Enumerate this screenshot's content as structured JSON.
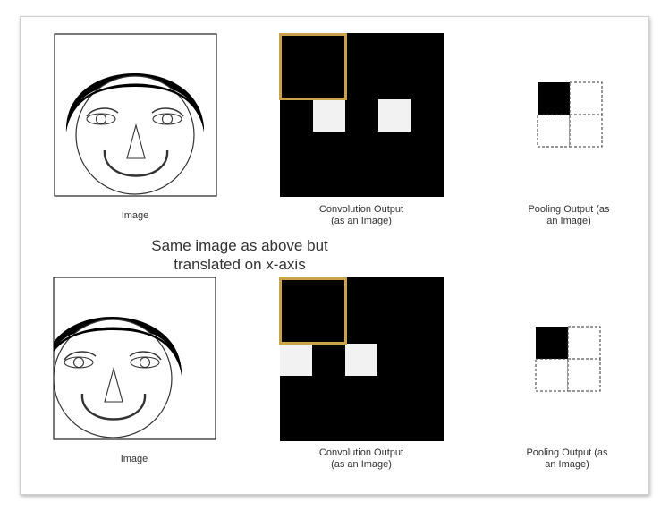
{
  "top_row": {
    "image_label": "Image",
    "conv_label_line1": "Convolution Output",
    "conv_label_line2": "(as an Image)",
    "pool_label_line1": "Pooling Output (as",
    "pool_label_line2": "an Image)"
  },
  "middle_caption": {
    "line1": "Same image as above but",
    "line2": "translated on x-axis"
  },
  "bottom_row": {
    "image_label": "Image",
    "conv_label_line1": "Convolution Output",
    "conv_label_line2": "(as an Image)",
    "pool_label_line1": "Pooling Output (as",
    "pool_label_line2": "an Image)"
  },
  "colors": {
    "highlight": "#c9a24a",
    "feature_map": "#000000",
    "activation": "#f2f2f2"
  }
}
